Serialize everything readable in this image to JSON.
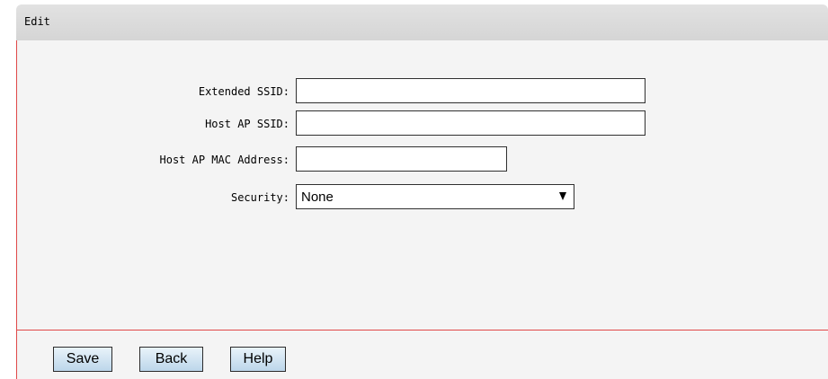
{
  "panel": {
    "title": "Edit"
  },
  "form": {
    "extended_ssid": {
      "label": "Extended SSID:",
      "value": ""
    },
    "host_ap_ssid": {
      "label": "Host AP SSID:",
      "value": ""
    },
    "host_ap_mac": {
      "label": "Host AP MAC Address:",
      "value": ""
    },
    "security": {
      "label": "Security:",
      "selected": "None"
    }
  },
  "buttons": {
    "save": "Save",
    "back": "Back",
    "help": "Help"
  },
  "colors": {
    "accent_border": "#e04848",
    "panel_bg": "#f4f4f4",
    "header_bg": "#d9d9d9"
  }
}
